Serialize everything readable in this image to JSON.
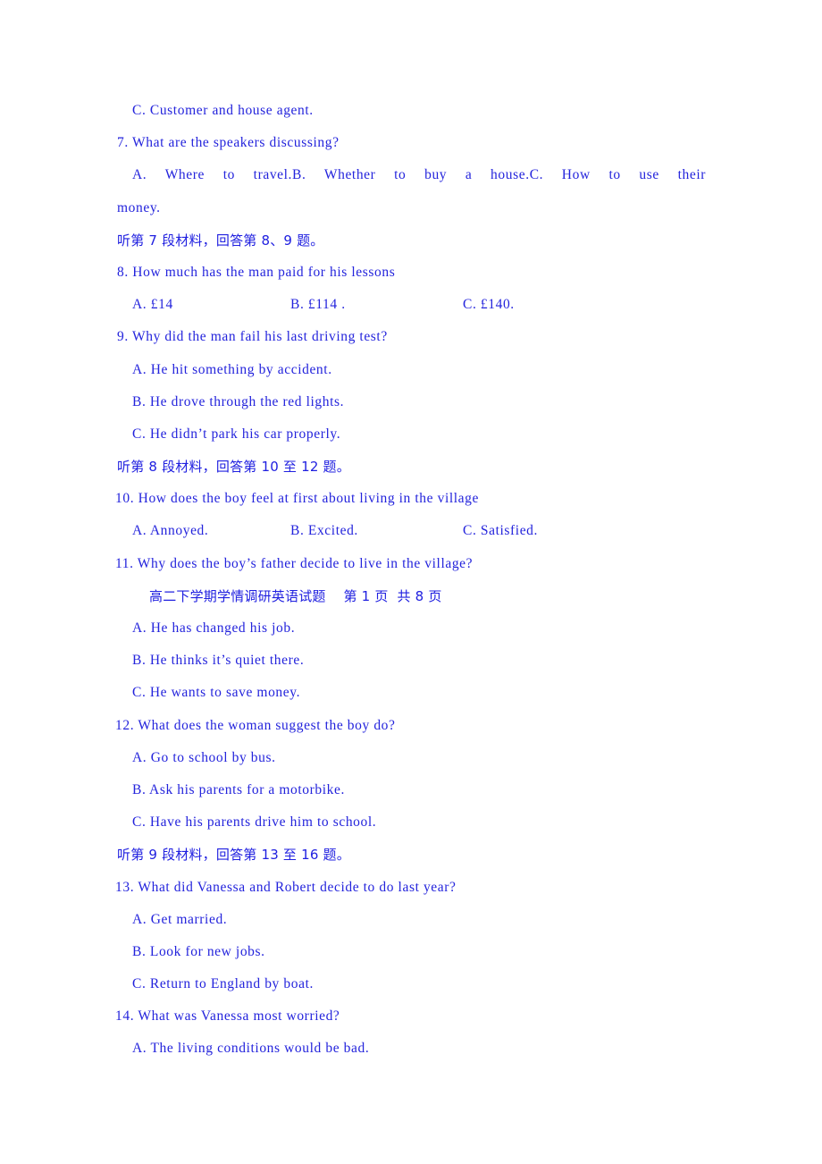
{
  "document": {
    "type": "exam-paper",
    "language": "en-zh",
    "text_color": "#2323dc",
    "background_color": "#ffffff"
  },
  "footer": {
    "text": "高二下学期学情调研英语试题    第 1 页  共 8 页",
    "page_number": "1",
    "total_pages": "8"
  },
  "lines": [
    {
      "id": "q6-optC",
      "kind": "option",
      "text": "C. Customer and house agent."
    },
    {
      "id": "q7-stem",
      "kind": "question",
      "text": "7. What are the speakers discussing?"
    },
    {
      "id": "q7-opts",
      "kind": "justified-row",
      "a": "A. Where to travel.",
      "b": "B. Whether to buy a house.",
      "c": "C. How to use their"
    },
    {
      "id": "q7-cont",
      "kind": "continuation",
      "text": "money."
    },
    {
      "id": "dir7",
      "kind": "chinese-direction",
      "text": "听第 7 段材料，回答第 8、9 题。"
    },
    {
      "id": "q8-stem",
      "kind": "question",
      "text": "8. How much has the man paid for his lessons"
    },
    {
      "id": "q8-opts",
      "kind": "option-row",
      "a": "A. £14",
      "b": "B. £114 .",
      "c": "C. £140."
    },
    {
      "id": "q9-stem",
      "kind": "question",
      "text": "9. Why did the man fail his last driving test?"
    },
    {
      "id": "q9-optA",
      "kind": "option",
      "text": "A. He hit something by accident."
    },
    {
      "id": "q9-optB",
      "kind": "option",
      "text": "B. He drove through the red lights."
    },
    {
      "id": "q9-optC",
      "kind": "option",
      "text": "C. He didn’t park his car properly."
    },
    {
      "id": "dir8",
      "kind": "chinese-direction",
      "text": "听第 8 段材料，回答第 10 至 12 题。"
    },
    {
      "id": "q10-stem",
      "kind": "question2",
      "text": "10. How does the boy feel at first about living in the village"
    },
    {
      "id": "q10-opts",
      "kind": "option-row",
      "a": "A. Annoyed.",
      "b": "B. Excited.",
      "c": "C. Satisfied."
    },
    {
      "id": "q11-stem",
      "kind": "question2",
      "text": "11. Why does the boy’s father decide to live in the village?"
    },
    {
      "id": "footer",
      "kind": "footer",
      "text": "高二下学期学情调研英语试题    第 1 页  共 8 页"
    },
    {
      "id": "q11-optA",
      "kind": "option",
      "text": "A. He has changed his job."
    },
    {
      "id": "q11-optB",
      "kind": "option",
      "text": "B. He thinks it’s quiet there."
    },
    {
      "id": "q11-optC",
      "kind": "option",
      "text": "C. He wants to save money."
    },
    {
      "id": "q12-stem",
      "kind": "question2",
      "text": "12. What does the woman suggest the boy do?"
    },
    {
      "id": "q12-optA",
      "kind": "option",
      "text": "A. Go to school by bus."
    },
    {
      "id": "q12-optB",
      "kind": "option",
      "text": "B. Ask his parents for a motorbike."
    },
    {
      "id": "q12-optC",
      "kind": "option",
      "text": "C. Have his parents drive him to school."
    },
    {
      "id": "dir9",
      "kind": "chinese-direction",
      "text": "听第 9 段材料，回答第 13 至 16 题。"
    },
    {
      "id": "q13-stem",
      "kind": "question2",
      "text": "13. What did Vanessa and Robert decide to do last year?"
    },
    {
      "id": "q13-optA",
      "kind": "option",
      "text": "A. Get married."
    },
    {
      "id": "q13-optB",
      "kind": "option",
      "text": "B. Look for new jobs."
    },
    {
      "id": "q13-optC",
      "kind": "option",
      "text": "C. Return to England by boat."
    },
    {
      "id": "q14-stem",
      "kind": "question2",
      "text": "14. What was Vanessa most worried?"
    },
    {
      "id": "q14-optA",
      "kind": "option",
      "text": "A. The living conditions would be bad."
    }
  ],
  "option_columns": {
    "b_offset_px": "194",
    "c_offset_px": "387"
  }
}
